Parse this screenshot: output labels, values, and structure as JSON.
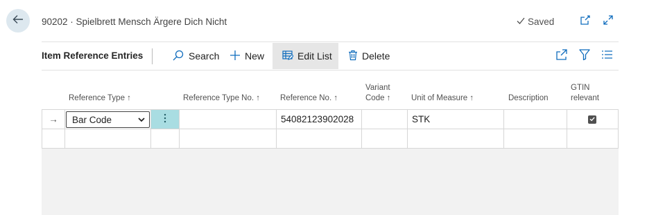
{
  "header": {
    "title": "90202 · Spielbrett Mensch Ärgere Dich Nicht",
    "saved_label": "Saved",
    "icons": [
      "back-arrow-icon",
      "checkmark-icon",
      "open-new-window-icon",
      "expand-icon"
    ]
  },
  "toolbar": {
    "title": "Item Reference Entries",
    "actions": [
      {
        "label": "Search",
        "icon": "search-icon"
      },
      {
        "label": "New",
        "icon": "plus-icon"
      },
      {
        "label": "Edit List",
        "icon": "edit-list-icon",
        "active": true
      },
      {
        "label": "Delete",
        "icon": "trash-icon"
      }
    ],
    "right_icons": [
      "share-icon",
      "filter-icon",
      "list-view-icon"
    ]
  },
  "grid": {
    "columns": [
      {
        "line1": "Reference Type ↑",
        "line2": ""
      },
      {
        "line1": "Reference Type No. ↑",
        "line2": ""
      },
      {
        "line1": "Reference No. ↑",
        "line2": ""
      },
      {
        "line1": "Variant",
        "line2": "Code ↑"
      },
      {
        "line1": "Unit of Measure ↑",
        "line2": ""
      },
      {
        "line1": "Description",
        "line2": ""
      },
      {
        "line1": "GTIN",
        "line2": "relevant"
      }
    ],
    "rows": [
      {
        "indicator": "→",
        "reference_type": "Bar Code",
        "reference_type_no": "",
        "reference_no": "54082123902028",
        "variant_code": "",
        "unit_of_measure": "STK",
        "description": "",
        "gtin_relevant": true
      },
      {
        "indicator": "",
        "reference_type": "",
        "reference_type_no": "",
        "reference_no": "",
        "variant_code": "",
        "unit_of_measure": "",
        "description": "",
        "gtin_relevant": false
      }
    ]
  },
  "colors": {
    "accent_teal": "#a9dde2",
    "back_button_bg": "#dde8ef",
    "icon_blue": "#0f6cbd"
  }
}
